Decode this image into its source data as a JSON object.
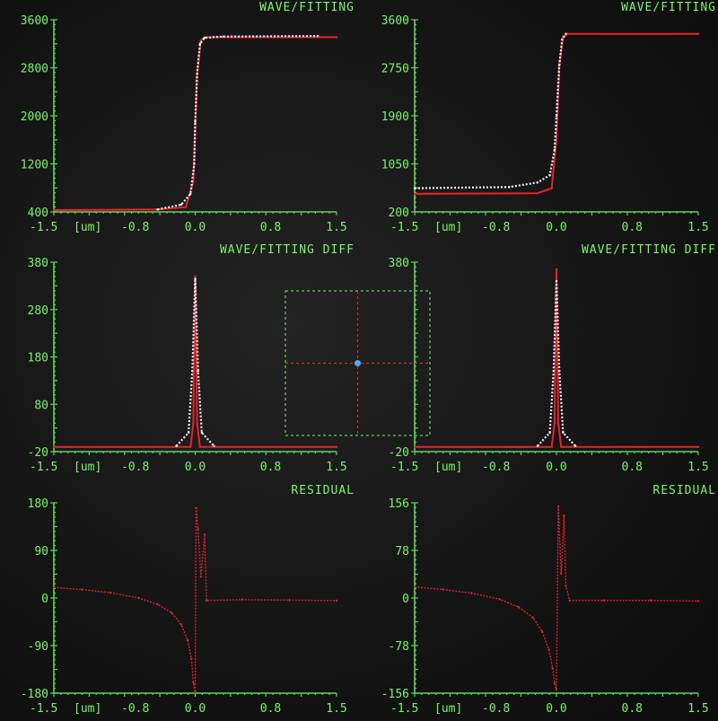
{
  "colors": {
    "axis": "#5fd45a",
    "label": "#7cf46c",
    "fit": "#e8232a",
    "wave": "#eef2ff",
    "residual": "#d8262a",
    "background": "#151515",
    "marker": "#4fa8ff"
  },
  "crosshair": {
    "icon": "crosshair-target-icon"
  },
  "chart_data": [
    {
      "id": "wave-left",
      "type": "line",
      "title": "WAVE/FITTING",
      "x_unit_label": "[um]",
      "x_ticks": [
        "-1.5",
        "-0.8",
        "0.0",
        "0.8",
        "1.5"
      ],
      "y_ticks": [
        "3600",
        "2800",
        "2000",
        "1200",
        "400"
      ],
      "xlim": [
        -1.5,
        1.5
      ],
      "ylim": [
        400,
        3600
      ],
      "series": [
        {
          "role": "fit",
          "x": [
            -1.5,
            -0.4,
            -0.1,
            -0.02,
            0.0,
            0.02,
            0.06,
            0.1,
            1.5
          ],
          "y": [
            430,
            440,
            480,
            900,
            1800,
            2700,
            3250,
            3310,
            3310
          ]
        },
        {
          "role": "wave",
          "x": [
            -0.4,
            -0.15,
            -0.05,
            -0.01,
            0.0,
            0.02,
            0.05,
            0.1,
            0.3,
            1.3
          ],
          "y": [
            440,
            520,
            700,
            1200,
            1900,
            2700,
            3200,
            3300,
            3320,
            3330
          ]
        }
      ]
    },
    {
      "id": "wave-right",
      "type": "line",
      "title": "WAVE/FITTING",
      "x_unit_label": "[um]",
      "x_ticks": [
        "-1.5",
        "-0.8",
        "0.0",
        "0.8",
        "1.5"
      ],
      "y_ticks": [
        "3600",
        "2750",
        "1900",
        "1050",
        "200"
      ],
      "xlim": [
        -1.5,
        1.5
      ],
      "ylim": [
        200,
        3600
      ],
      "series": [
        {
          "role": "fit",
          "x": [
            -1.5,
            -0.2,
            -0.05,
            0.0,
            0.03,
            0.07,
            0.12,
            1.5
          ],
          "y": [
            520,
            530,
            620,
            1500,
            2800,
            3300,
            3350,
            3350
          ]
        },
        {
          "role": "wave",
          "x": [
            -1.5,
            -0.5,
            -0.2,
            -0.07,
            -0.02,
            0.0,
            0.03,
            0.06,
            0.1
          ],
          "y": [
            620,
            640,
            720,
            850,
            1300,
            1900,
            2800,
            3250,
            3350
          ]
        }
      ]
    },
    {
      "id": "diff-left",
      "type": "line",
      "title": "WAVE/FITTING DIFF",
      "x_unit_label": "[um]",
      "x_ticks": [
        "-1.5",
        "-0.8",
        "0.0",
        "0.8",
        "1.5"
      ],
      "y_ticks": [
        "380",
        "280",
        "180",
        "80",
        "-20"
      ],
      "xlim": [
        -1.5,
        1.5
      ],
      "ylim": [
        -20,
        380
      ],
      "series": [
        {
          "role": "fit",
          "x": [
            -1.5,
            -0.05,
            -0.02,
            0.0,
            0.02,
            0.05,
            1.5
          ],
          "y": [
            -10,
            -10,
            40,
            350,
            40,
            -10,
            -10
          ]
        },
        {
          "role": "wave",
          "x": [
            -0.2,
            -0.07,
            -0.03,
            0.0,
            0.03,
            0.07,
            0.2
          ],
          "y": [
            -8,
            20,
            150,
            345,
            150,
            20,
            -8
          ]
        }
      ]
    },
    {
      "id": "diff-right",
      "type": "line",
      "title": "WAVE/FITTING DIFF",
      "x_unit_label": "[um]",
      "x_ticks": [
        "-1.5",
        "-0.8",
        "0.0",
        "0.8",
        "1.5"
      ],
      "y_ticks": [
        "380",
        "-20"
      ],
      "xlim": [
        -1.5,
        1.5
      ],
      "ylim": [
        -20,
        380
      ],
      "series": [
        {
          "role": "fit",
          "x": [
            -1.5,
            -0.05,
            -0.02,
            0.0,
            0.02,
            0.05,
            1.5
          ],
          "y": [
            -10,
            -10,
            40,
            365,
            40,
            -10,
            -10
          ]
        },
        {
          "role": "wave",
          "x": [
            -0.2,
            -0.07,
            -0.03,
            0.0,
            0.03,
            0.07,
            0.2
          ],
          "y": [
            -8,
            20,
            150,
            340,
            150,
            20,
            -8
          ]
        }
      ]
    },
    {
      "id": "residual-left",
      "type": "line",
      "title": "RESIDUAL",
      "x_unit_label": "[um]",
      "x_ticks": [
        "-1.5",
        "-0.8",
        "0.0",
        "0.8",
        "1.5"
      ],
      "y_ticks": [
        "180",
        "90",
        "0",
        "-90",
        "-180"
      ],
      "xlim": [
        -1.5,
        1.5
      ],
      "ylim": [
        -180,
        180
      ],
      "series": [
        {
          "role": "residual",
          "x": [
            -1.5,
            -1.2,
            -0.9,
            -0.6,
            -0.4,
            -0.25,
            -0.15,
            -0.08,
            -0.04,
            -0.02,
            0.0,
            0.01,
            0.03,
            0.06,
            0.1,
            0.12,
            0.5,
            1.0,
            1.5
          ],
          "y": [
            20,
            16,
            10,
            0,
            -12,
            -28,
            -50,
            -80,
            -115,
            -160,
            -178,
            170,
            130,
            40,
            120,
            -5,
            -3,
            -4,
            -5
          ]
        }
      ]
    },
    {
      "id": "residual-right",
      "type": "line",
      "title": "RESIDUAL",
      "x_unit_label": "[um]",
      "x_ticks": [
        "-1.5",
        "-0.8",
        "0.0",
        "0.8",
        "1.5"
      ],
      "y_ticks": [
        "156",
        "78",
        "0",
        "-78",
        "-156"
      ],
      "xlim": [
        -1.5,
        1.5
      ],
      "ylim": [
        -156,
        156
      ],
      "series": [
        {
          "role": "residual",
          "x": [
            -1.5,
            -1.2,
            -0.9,
            -0.6,
            -0.4,
            -0.25,
            -0.15,
            -0.08,
            -0.04,
            -0.02,
            0.0,
            0.02,
            0.05,
            0.08,
            0.1,
            0.14,
            0.5,
            1.0,
            1.5
          ],
          "y": [
            18,
            14,
            8,
            -2,
            -15,
            -32,
            -55,
            -85,
            -115,
            -140,
            -150,
            150,
            40,
            135,
            20,
            -4,
            -4,
            -4,
            -5
          ]
        }
      ]
    }
  ]
}
